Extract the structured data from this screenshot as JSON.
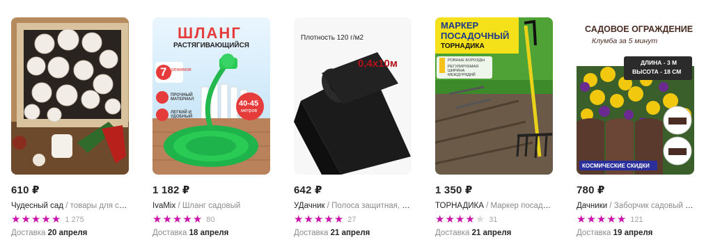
{
  "products": [
    {
      "price": "610 ₽",
      "brand": "Чудесный сад",
      "name": "товары для сада и...",
      "rating_stars": 5,
      "review_count": "1 275",
      "delivery_label": "Доставка",
      "delivery_date": "20 апреля",
      "image_icon": "mushroom-box-image",
      "image_text": {}
    },
    {
      "price": "1 182 ₽",
      "brand": "IvaMix",
      "name": "Шланг садовый",
      "rating_stars": 5,
      "review_count": "80",
      "delivery_label": "Доставка",
      "delivery_date": "18 апреля",
      "image_icon": "green-hose-image",
      "image_text": {
        "title": "ШЛАНГ",
        "subtitle": "РАСТЯГИВАЮЩИЙСЯ",
        "modes_num": "7",
        "modes_text": "режимов",
        "feature1": "ПРОЧНЫЙ МАТЕРИАЛ",
        "feature2": "ЛЕГКИЙ И УДОБНЫЙ",
        "length": "40-45",
        "length_unit": "метров"
      }
    },
    {
      "price": "642 ₽",
      "brand": "УДачник",
      "name": "Полоса защитная, сад...",
      "rating_stars": 5,
      "review_count": "27",
      "delivery_label": "Доставка",
      "delivery_date": "21 апреля",
      "image_icon": "black-fabric-roll-image",
      "image_text": {
        "density": "Плотность 120 г/м2",
        "size": "0,4х10м"
      }
    },
    {
      "price": "1 350 ₽",
      "brand": "ТОРНАДИКА",
      "name": "Маркер посадочн...",
      "rating_stars": 4,
      "review_count": "31",
      "delivery_label": "Доставка",
      "delivery_date": "21 апреля",
      "image_icon": "planting-marker-image",
      "image_text": {
        "title1": "МАРКЕР",
        "title2": "ПОСАДОЧНЫЙ",
        "brand": "ТОРНАДИКА",
        "feature1": "РОВНЫЕ БОРОЗДЫ",
        "feature2": "РЕГУЛИРУЕМАЯ ШИРИНА МЕЖДУРЯДИЙ"
      }
    },
    {
      "price": "780 ₽",
      "brand": "Дачники",
      "name": "Заборчик садовый пл...",
      "rating_stars": 5,
      "review_count": "121",
      "delivery_label": "Доставка",
      "delivery_date": "19 апреля",
      "image_icon": "garden-fence-image",
      "image_text": {
        "title": "САДОВОЕ ОГРАЖДЕНИЕ",
        "subtitle": "Клумба за 5 минут",
        "length": "ДЛИНА - 3 М",
        "height": "ВЫСОТА - 18 СМ",
        "badge": "КОСМИЧЕСКИЕ СКИДКИ"
      }
    }
  ],
  "colors": {
    "accent": "#cb11ab",
    "star_empty": "#d9d9d9",
    "muted_text": "#8b8b8b"
  }
}
